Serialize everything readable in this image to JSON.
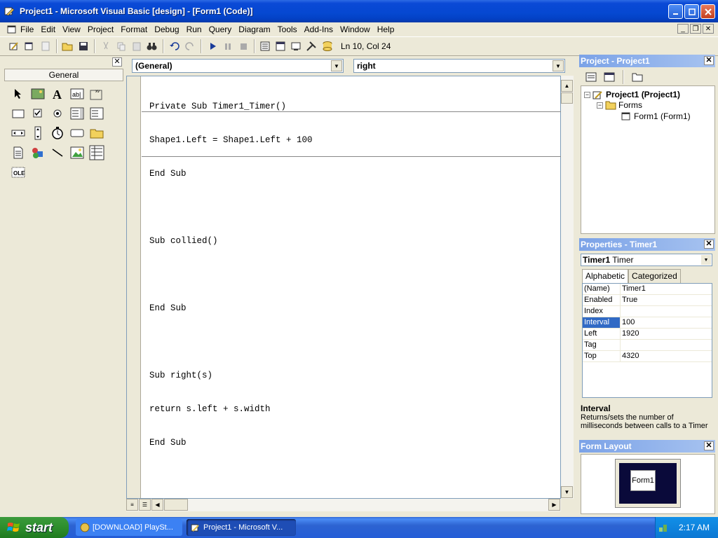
{
  "window": {
    "title": "Project1 - Microsoft Visual Basic [design] - [Form1 (Code)]"
  },
  "menu": [
    "File",
    "Edit",
    "View",
    "Project",
    "Format",
    "Debug",
    "Run",
    "Query",
    "Diagram",
    "Tools",
    "Add-Ins",
    "Window",
    "Help"
  ],
  "toolbar": {
    "status": "Ln 10, Col 24"
  },
  "toolbox": {
    "tab": "General"
  },
  "code_window": {
    "object_combo": "(General)",
    "procedure_combo": "right",
    "lines": [
      "Private Sub Timer1_Timer()",
      "Shape1.Left = Shape1.Left + 100",
      "End Sub",
      "",
      "Sub collied()",
      "",
      "End Sub",
      "",
      "Sub right(s)",
      "return s.left + s.width",
      "End Sub"
    ]
  },
  "project_panel": {
    "title": "Project - Project1",
    "tree": {
      "root": "Project1 (Project1)",
      "folder": "Forms",
      "item": "Form1 (Form1)"
    }
  },
  "properties_panel": {
    "title": "Properties - Timer1",
    "object_name": "Timer1",
    "object_type": "Timer",
    "tabs": [
      "Alphabetic",
      "Categorized"
    ],
    "rows": [
      {
        "name": "(Name)",
        "value": "Timer1"
      },
      {
        "name": "Enabled",
        "value": "True"
      },
      {
        "name": "Index",
        "value": ""
      },
      {
        "name": "Interval",
        "value": "100"
      },
      {
        "name": "Left",
        "value": "1920"
      },
      {
        "name": "Tag",
        "value": ""
      },
      {
        "name": "Top",
        "value": "4320"
      }
    ],
    "selected_row": "Interval",
    "description_title": "Interval",
    "description_text": "Returns/sets the number of milliseconds between calls to a Timer"
  },
  "form_layout": {
    "title": "Form Layout",
    "form_label": "Form1"
  },
  "taskbar": {
    "start": "start",
    "tasks": [
      "[DOWNLOAD] PlaySt...",
      "Project1 - Microsoft V..."
    ],
    "clock": "2:17 AM"
  },
  "colors": {
    "titlebar": "#0548D1",
    "panel_title": "#7BA2E7",
    "selection": "#316AC5",
    "start": "#2D8E2D"
  }
}
